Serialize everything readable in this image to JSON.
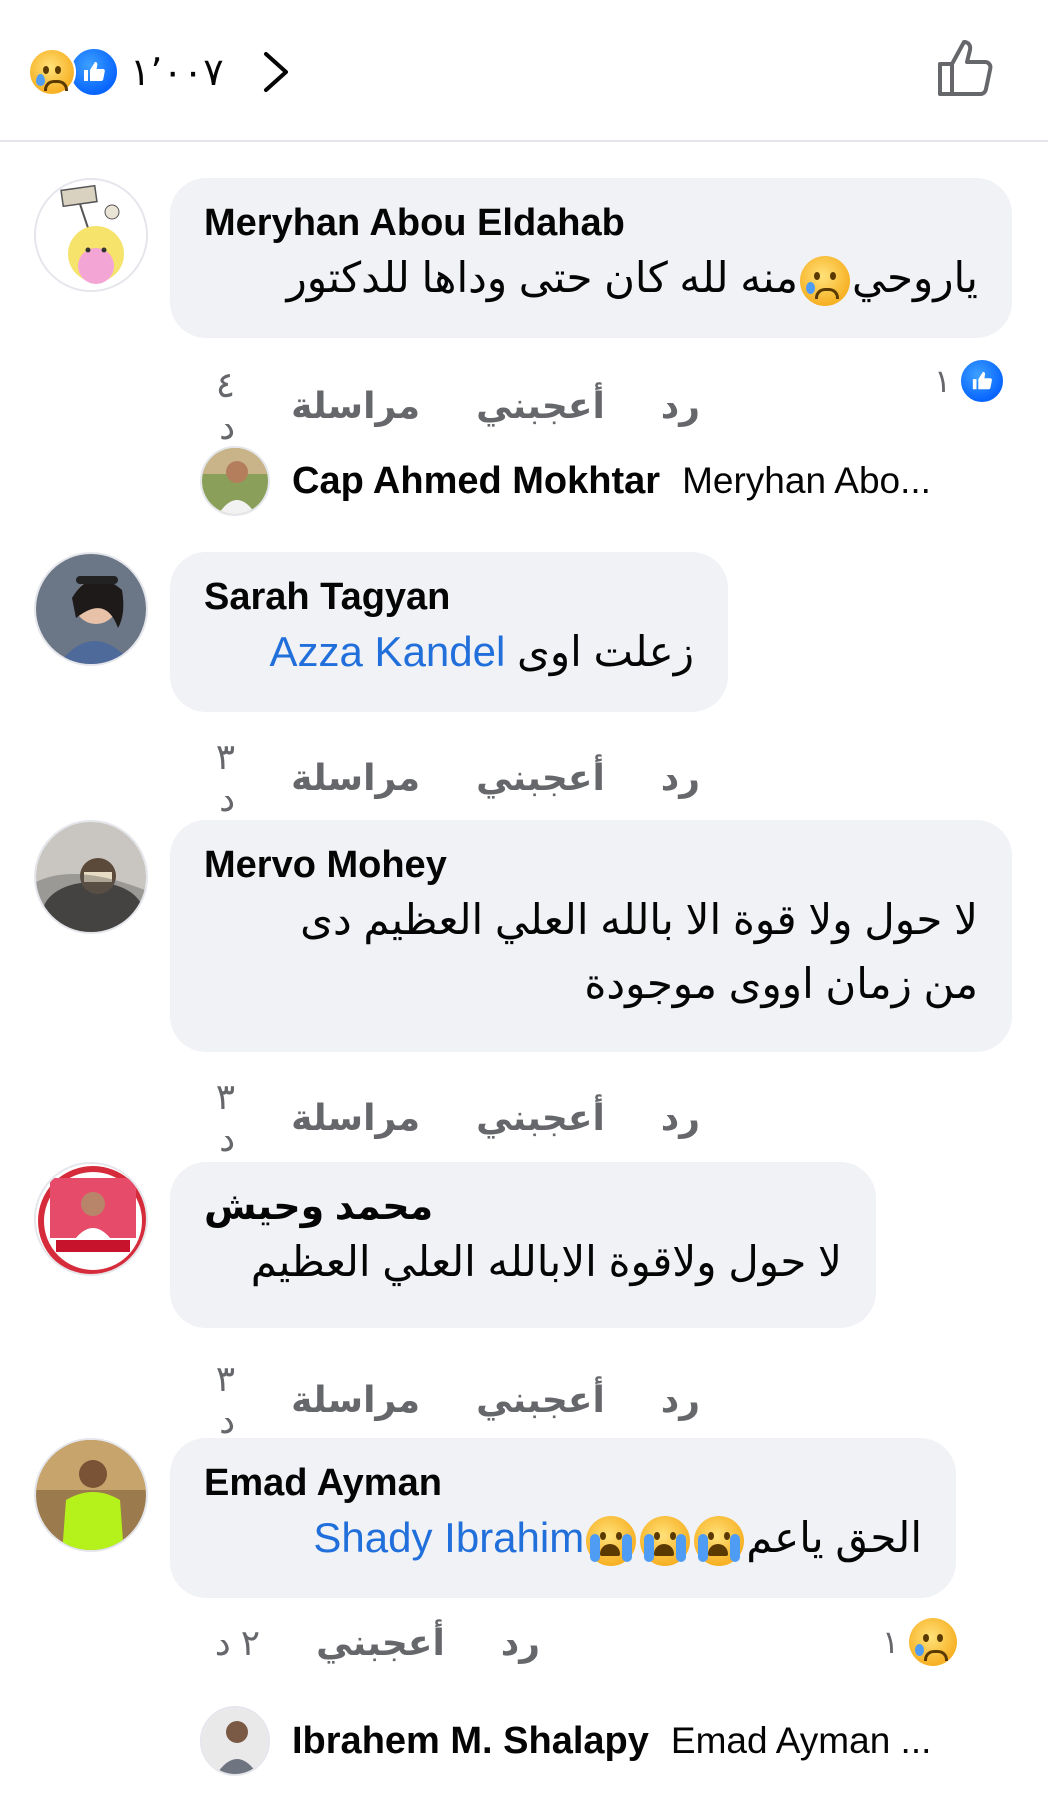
{
  "header": {
    "reaction_count": "١٬٠٠٧",
    "reaction_icons": [
      "sad-emoji-icon",
      "like-icon"
    ],
    "like_button_icon": "thumbs-up-outline-icon"
  },
  "colors": {
    "accent": "#0866ff",
    "bubble": "#f0f2f5",
    "muted": "#65676b",
    "mention": "#216fdb"
  },
  "comments": [
    {
      "author": "Meryhan Abou Eldahab",
      "text_before": "ياروحي",
      "text_after": "منه لله كان حتى وداها للدكتور",
      "emoji": "sad-emoji-icon",
      "actions": {
        "reply": "رد",
        "like": "أعجبني",
        "message": "مراسلة",
        "time": "٤ د"
      },
      "reactions": {
        "count": "١",
        "icon": "like-icon"
      },
      "reply_preview": {
        "name": "Cap Ahmed Mokhtar",
        "text": "Meryhan Abo..."
      }
    },
    {
      "author": "Sarah Tagyan",
      "mention": "Azza Kandel",
      "text": "زعلت اوى",
      "actions": {
        "reply": "رد",
        "like": "أعجبني",
        "message": "مراسلة",
        "time": "٣ د"
      }
    },
    {
      "author": "Mervo Mohey",
      "line1": "لا حول ولا قوة الا بالله العلي العظيم دى",
      "line2": "من زمان اووى موجودة",
      "actions": {
        "reply": "رد",
        "like": "أعجبني",
        "message": "مراسلة",
        "time": "٣ د"
      }
    },
    {
      "author": "محمد وحيش",
      "text": "لا حول ولاقوة الابالله العلي العظيم",
      "actions": {
        "reply": "رد",
        "like": "أعجبني",
        "message": "مراسلة",
        "time": "٣ د"
      }
    },
    {
      "author": "Emad Ayman",
      "mention": "Shady Ibrahim",
      "text": "الحق ياعم",
      "emoji": "crying-emoji-icon",
      "actions": {
        "reply": "رد",
        "like": "أعجبني",
        "time": "٢ د"
      },
      "reactions": {
        "count": "١",
        "icon": "sad-emoji-icon"
      },
      "reply_preview": {
        "name": "Ibrahem M. Shalapy",
        "text": "Emad Ayman ..."
      }
    }
  ]
}
